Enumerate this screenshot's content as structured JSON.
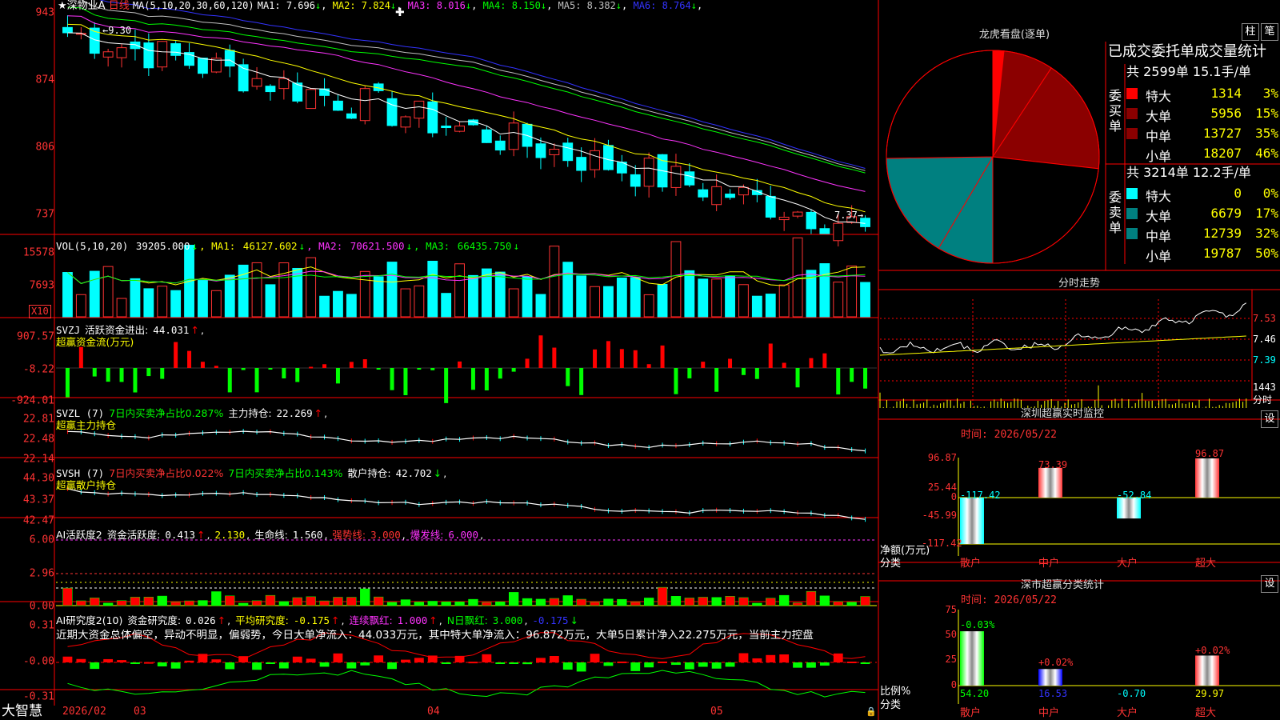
{
  "app": {
    "brand": "大智慧"
  },
  "main": {
    "star": "★",
    "stock_name": "深物业A",
    "period": "日线",
    "ma_label": "MA(5,10,20,30,60,120)",
    "ma": [
      {
        "label": "MA1:",
        "value": "7.696",
        "arrow": "↓",
        "color": "#ffffff"
      },
      {
        "label": "MA2:",
        "value": "7.824",
        "arrow": "↓",
        "color": "#ffff00"
      },
      {
        "label": "MA3:",
        "value": "8.016",
        "arrow": "↓",
        "color": "#ff33ff"
      },
      {
        "label": "MA4:",
        "value": "8.150",
        "arrow": "↓",
        "color": "#00ff00"
      },
      {
        "label": "MA5:",
        "value": "8.382",
        "arrow": "↓",
        "color": "#c0c0c0"
      },
      {
        "label": "MA6:",
        "value": "8.764",
        "arrow": "↓",
        "color": "#3333ff"
      }
    ],
    "y_ticks": [
      "943",
      "874",
      "806",
      "737"
    ],
    "high_label": "←9.30",
    "low_label": "7.37→"
  },
  "vol": {
    "title": "VOL(5,10,20)",
    "value": "39205.000",
    "arrow": "↓",
    "ma": [
      {
        "label": "MA1:",
        "value": "46127.602",
        "arrow": "↓",
        "color": "#ffff00"
      },
      {
        "label": "MA2:",
        "value": "70621.500",
        "arrow": "↓",
        "color": "#ff33ff"
      },
      {
        "label": "MA3:",
        "value": "66435.750",
        "arrow": "↓",
        "color": "#00ff00"
      }
    ],
    "y_ticks": [
      "15578",
      "7693"
    ],
    "unit": "X10"
  },
  "svzj": {
    "title": "SVZJ",
    "line1": "活跃资金进出:",
    "line1_value": "44.031",
    "arrow": "↑",
    "line2": "超赢资金流(万元)",
    "y_ticks": [
      "907.57",
      "-8.22",
      "-924.01"
    ]
  },
  "svzl": {
    "title": "SVZL (7)",
    "a": "7日内买卖净占比0.287%",
    "b": "主力持仓:",
    "b_value": "22.269",
    "arrow": "↑",
    "line2": "超赢主力持仓",
    "y_ticks": [
      "22.81",
      "22.48",
      "22.14"
    ]
  },
  "svsh": {
    "title": "SVSH (7)",
    "a": "7日内买卖净占比0.022%",
    "b": "7日内买卖净占比0.143%",
    "c": "散户持仓:",
    "c_value": "42.702",
    "arrow": "↓",
    "line2": "超赢散户持仓",
    "y_ticks": [
      "44.30",
      "43.37",
      "42.47"
    ]
  },
  "ai1": {
    "title": "AI活跃度2",
    "a": "资金活跃度:",
    "a_value": "0.413",
    "a_arrow": "↑",
    "b_value": "2.130",
    "c": "生命线:",
    "c_value": "1.560",
    "d": "强势线:",
    "d_value": "3.000",
    "e": "爆发线:",
    "e_value": "6.000",
    "y_ticks": [
      "6.00",
      "2.96",
      "0.00"
    ]
  },
  "ai2": {
    "title": "AI研究度2(10)",
    "a": "资金研究度:",
    "a_value": "0.026",
    "a_arrow": "↑",
    "b": "平均研究度:",
    "b_value": "-0.175",
    "b_arrow": "↑",
    "c": "连续飘红:",
    "c_value": "1.000",
    "c_arrow": "↑",
    "d": "N日飘红:",
    "d_value": "3.000",
    "e_value": "-0.175",
    "e_arrow": "↓",
    "commentary": "近期大资金总体偏空，异动不明显，偏弱势，今日大单净流入：44.033万元，其中特大单净流入：96.872万元，大单5日累计净入22.275万元，当前主力控盘",
    "y_ticks": [
      "0.31",
      "-0.00",
      "-0.31"
    ]
  },
  "x_axis": {
    "labels": [
      "2026/02",
      "03",
      "04",
      "05"
    ]
  },
  "dragon": {
    "title": "龙虎看盘(逐单)",
    "btn1": "柱",
    "btn2": "笔",
    "header": "已成交委托单成交量统计",
    "buy_label": "委买单",
    "buy_total": "共 2599单 15.1手/单",
    "buy_rows": [
      {
        "name": "特大",
        "vol": "1314",
        "pct": "3%",
        "color": "#ff0000"
      },
      {
        "name": "大单",
        "vol": "5956",
        "pct": "15%",
        "color": "#8b0000"
      },
      {
        "name": "中单",
        "vol": "13727",
        "pct": "35%",
        "color": "#8b0000"
      },
      {
        "name": "小单",
        "vol": "18207",
        "pct": "46%",
        "color": "#000000"
      }
    ],
    "sell_label": "委卖单",
    "sell_total": "共 3214单 12.2手/单",
    "sell_rows": [
      {
        "name": "特大",
        "vol": "0",
        "pct": "0%",
        "color": "#00ffff"
      },
      {
        "name": "大单",
        "vol": "6679",
        "pct": "17%",
        "color": "#008080"
      },
      {
        "name": "中单",
        "vol": "12739",
        "pct": "32%",
        "color": "#008080"
      },
      {
        "name": "小单",
        "vol": "19787",
        "pct": "50%",
        "color": "#000000"
      }
    ]
  },
  "intraday": {
    "title": "分时走势",
    "y_ticks": [
      "7.53",
      "7.46",
      "7.39"
    ],
    "vol_tick": "1443",
    "vol_unit": "分时"
  },
  "monitor": {
    "title": "深圳超赢实时监控",
    "set": "设",
    "time": "时间: 2026/05/22",
    "y_ticks": [
      "96.87",
      "25.44",
      "0",
      "-45.99",
      "-117.42"
    ],
    "y_label": "净额(万元)",
    "x_label": "分类",
    "categories": [
      "散户",
      "中户",
      "大户",
      "超大"
    ],
    "value_labels": [
      "-117.42",
      "73.39",
      "-52.84",
      "96.87"
    ]
  },
  "classify": {
    "title": "深市超赢分类统计",
    "set": "设",
    "time": "时间: 2026/05/22",
    "y_ticks": [
      "75",
      "50",
      "25",
      "0"
    ],
    "y_label": "比例%",
    "x_label": "分类",
    "categories": [
      "散户",
      "中户",
      "大户",
      "超大"
    ],
    "change_labels": [
      "-0.03%",
      "+0.02%",
      "",
      "+0.02%"
    ],
    "value_labels": [
      "54.20",
      "16.53",
      "-0.70",
      "29.97"
    ]
  },
  "chart_data": [
    {
      "type": "pie",
      "title": "龙虎看盘(逐单)",
      "categories": [
        "委买特大",
        "委买大单",
        "委买中单",
        "委买小单",
        "委卖特大",
        "委卖大单",
        "委卖中单",
        "委卖小单"
      ],
      "values": [
        1314,
        5956,
        13727,
        18207,
        0,
        6679,
        12739,
        19787
      ]
    },
    {
      "type": "bar",
      "title": "深圳超赢实时监控",
      "categories": [
        "散户",
        "中户",
        "大户",
        "超大"
      ],
      "values": [
        -117.42,
        73.39,
        -52.84,
        96.87
      ],
      "ylabel": "净额(万元)",
      "xlabel": "分类",
      "ylim": [
        -117.42,
        96.87
      ]
    },
    {
      "type": "bar",
      "title": "深市超赢分类统计",
      "categories": [
        "散户",
        "中户",
        "大户",
        "超大"
      ],
      "values": [
        54.2,
        16.53,
        -0.7,
        29.97
      ],
      "ylabel": "比例%",
      "xlabel": "分类",
      "ylim": [
        0,
        75
      ]
    },
    {
      "type": "candlestick",
      "title": "深物业A 日线",
      "x": [
        "2026/02",
        "03",
        "04",
        "05"
      ],
      "close_last": 7.37,
      "high_marker": 9.3,
      "ylim": [
        7.37,
        9.43
      ],
      "ma_series": [
        {
          "name": "MA1",
          "value": 7.696
        },
        {
          "name": "MA2",
          "value": 7.824
        },
        {
          "name": "MA3",
          "value": 8.016
        },
        {
          "name": "MA4",
          "value": 8.15
        },
        {
          "name": "MA5",
          "value": 8.382
        },
        {
          "name": "MA6",
          "value": 8.764
        }
      ],
      "volume_last": 39205.0,
      "volume_ma": [
        {
          "name": "MA1",
          "value": 46127.602
        },
        {
          "name": "MA2",
          "value": 70621.5
        },
        {
          "name": "MA3",
          "value": 66435.75
        }
      ]
    }
  ]
}
